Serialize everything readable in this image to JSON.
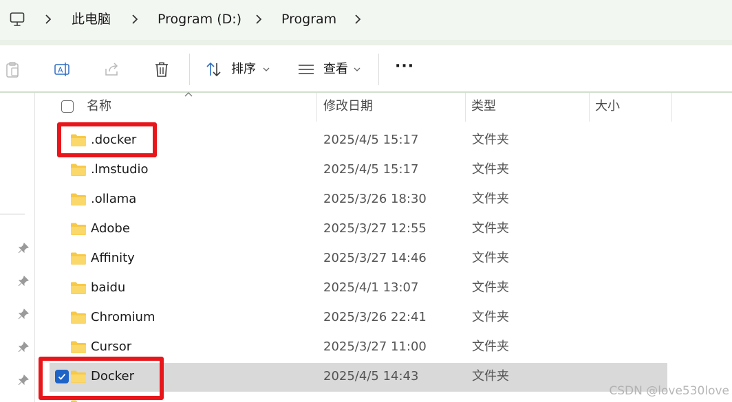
{
  "breadcrumb": {
    "icon": "pc-monitor-icon",
    "items": [
      "此电脑",
      "Program (D:)",
      "Program"
    ]
  },
  "toolbar": {
    "sort_label": "排序",
    "view_label": "查看",
    "more_label": "···"
  },
  "columns": {
    "name": "名称",
    "modified": "修改日期",
    "type": "类型",
    "size": "大小"
  },
  "rows": [
    {
      "name": ".docker",
      "modified": "2025/4/5 15:17",
      "type": "文件夹",
      "selected": false
    },
    {
      "name": ".lmstudio",
      "modified": "2025/4/5 15:17",
      "type": "文件夹",
      "selected": false
    },
    {
      "name": ".ollama",
      "modified": "2025/3/26 18:30",
      "type": "文件夹",
      "selected": false
    },
    {
      "name": "Adobe",
      "modified": "2025/3/27 12:55",
      "type": "文件夹",
      "selected": false
    },
    {
      "name": "Affinity",
      "modified": "2025/3/27 14:46",
      "type": "文件夹",
      "selected": false
    },
    {
      "name": "baidu",
      "modified": "2025/4/1 13:07",
      "type": "文件夹",
      "selected": false
    },
    {
      "name": "Chromium",
      "modified": "2025/3/26 22:41",
      "type": "文件夹",
      "selected": false
    },
    {
      "name": "Cursor",
      "modified": "2025/3/27 11:00",
      "type": "文件夹",
      "selected": false
    },
    {
      "name": "Docker",
      "modified": "2025/4/5 14:43",
      "type": "文件夹",
      "selected": true
    }
  ],
  "watermark": "CSDN @love530love",
  "colors": {
    "highlight": "#e8161a",
    "selection": "#d9d9d9",
    "checkbox": "#1e63c6",
    "folder": "#f7c948"
  }
}
